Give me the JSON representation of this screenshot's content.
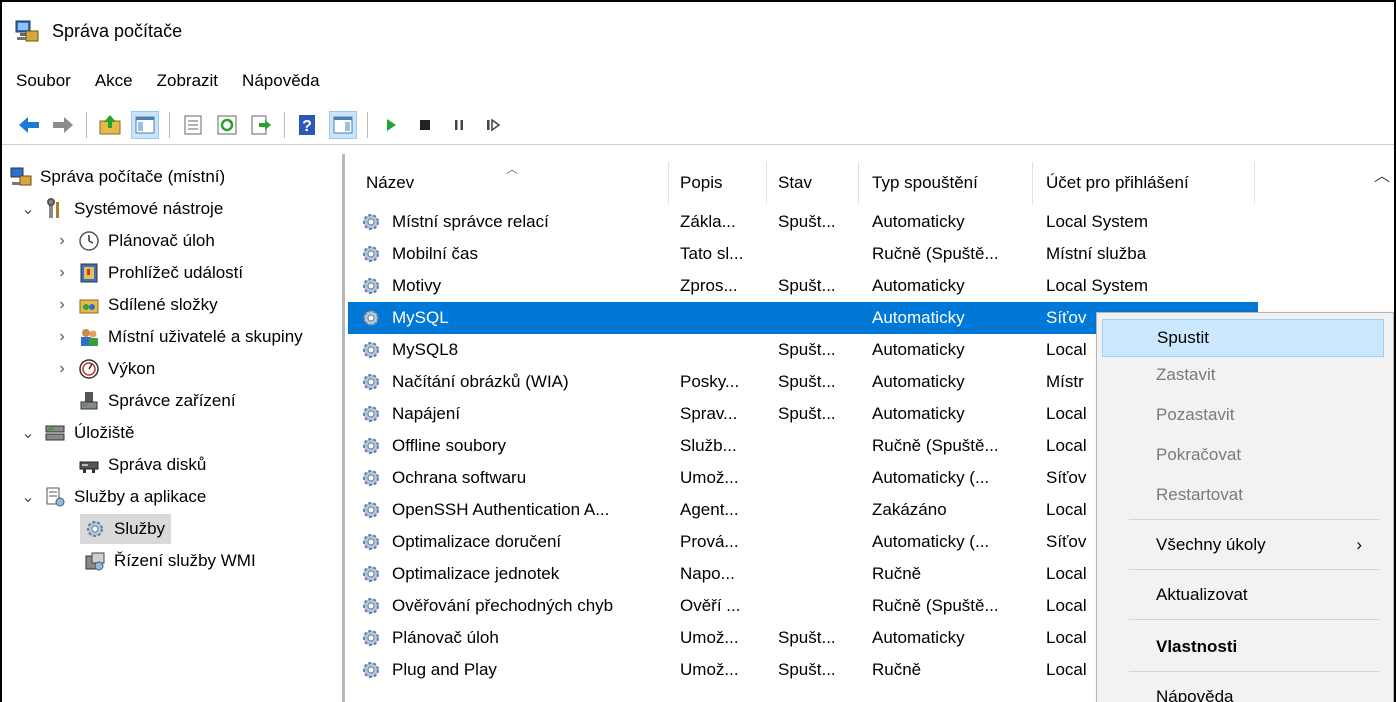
{
  "window": {
    "title": "Správa počítače"
  },
  "menu": [
    "Soubor",
    "Akce",
    "Zobrazit",
    "Nápověda"
  ],
  "toolbar_icons": [
    "back-icon",
    "forward-icon",
    "up-folder-icon",
    "show-tree-icon",
    "properties-icon",
    "refresh-icon",
    "export-icon",
    "help-icon",
    "show-action-pane-icon",
    "start-service-icon",
    "stop-service-icon",
    "pause-service-icon",
    "resume-service-icon"
  ],
  "tree": {
    "root": "Správa počítače (místní)",
    "system_tools": "Systémové nástroje",
    "task_scheduler": "Plánovač úloh",
    "event_viewer": "Prohlížeč událostí",
    "shared_folders": "Sdílené složky",
    "local_users": "Místní uživatelé a skupiny",
    "performance": "Výkon",
    "device_manager": "Správce zařízení",
    "storage": "Úložiště",
    "disk_management": "Správa disků",
    "services_apps": "Služby a aplikace",
    "services": "Služby",
    "wmi": "Řízení služby WMI"
  },
  "columns": {
    "name": "Název",
    "desc": "Popis",
    "status": "Stav",
    "startup": "Typ spouštění",
    "logon": "Účet pro přihlášení"
  },
  "services": [
    {
      "name": "Místní správce relací",
      "desc": "Zákla...",
      "status": "Spušt...",
      "startup": "Automaticky",
      "logon": "Local System"
    },
    {
      "name": "Mobilní čas",
      "desc": "Tato sl...",
      "status": "",
      "startup": "Ručně (Spuště...",
      "logon": "Místní služba"
    },
    {
      "name": "Motivy",
      "desc": "Zpros...",
      "status": "Spušt...",
      "startup": "Automaticky",
      "logon": "Local System"
    },
    {
      "name": "MySQL",
      "desc": "",
      "status": "",
      "startup": "Automaticky",
      "logon": "Síťov"
    },
    {
      "name": "MySQL8",
      "desc": "",
      "status": "Spušt...",
      "startup": "Automaticky",
      "logon": "Local"
    },
    {
      "name": "Načítání obrázků (WIA)",
      "desc": "Posky...",
      "status": "Spušt...",
      "startup": "Automaticky",
      "logon": "Místr"
    },
    {
      "name": "Napájení",
      "desc": "Sprav...",
      "status": "Spušt...",
      "startup": "Automaticky",
      "logon": "Local"
    },
    {
      "name": "Offline soubory",
      "desc": "Služb...",
      "status": "",
      "startup": "Ručně (Spuště...",
      "logon": "Local"
    },
    {
      "name": "Ochrana softwaru",
      "desc": "Umož...",
      "status": "",
      "startup": "Automaticky (...",
      "logon": "Síťov"
    },
    {
      "name": "OpenSSH Authentication A...",
      "desc": "Agent...",
      "status": "",
      "startup": "Zakázáno",
      "logon": "Local"
    },
    {
      "name": "Optimalizace doručení",
      "desc": "Prová...",
      "status": "",
      "startup": "Automaticky (...",
      "logon": "Síťov"
    },
    {
      "name": "Optimalizace jednotek",
      "desc": "Napo...",
      "status": "",
      "startup": "Ručně",
      "logon": "Local"
    },
    {
      "name": "Ověřování přechodných chyb",
      "desc": "Ověří ...",
      "status": "",
      "startup": "Ručně (Spuště...",
      "logon": "Local"
    },
    {
      "name": "Plánovač úloh",
      "desc": "Umož...",
      "status": "Spušt...",
      "startup": "Automaticky",
      "logon": "Local"
    },
    {
      "name": "Plug and Play",
      "desc": "Umož...",
      "status": "Spušt...",
      "startup": "Ručně",
      "logon": "Local"
    }
  ],
  "selected_service": "MySQL",
  "context_menu": {
    "start": "Spustit",
    "stop": "Zastavit",
    "pause": "Pozastavit",
    "resume": "Pokračovat",
    "restart": "Restartovat",
    "all_tasks": "Všechny úkoly",
    "refresh": "Aktualizovat",
    "properties": "Vlastnosti",
    "help": "Nápověda"
  },
  "colors": {
    "selection": "#0078d7",
    "menu_highlight": "#cce8ff",
    "menu_bg": "#f2f2f2"
  }
}
